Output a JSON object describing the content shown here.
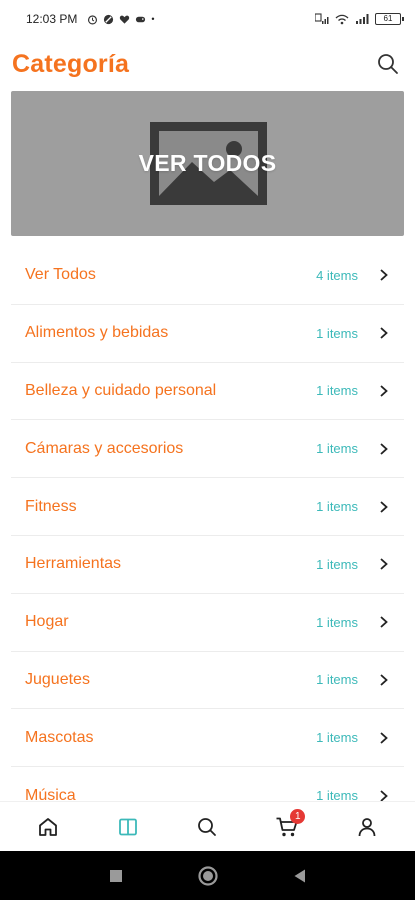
{
  "status_bar": {
    "time": "12:03 PM",
    "battery": "61"
  },
  "header": {
    "title": "Categoría"
  },
  "banner": {
    "label": "VER TODOS"
  },
  "categories": [
    {
      "name": "Ver Todos",
      "count": "4 items"
    },
    {
      "name": "Alimentos y bebidas",
      "count": "1 items"
    },
    {
      "name": "Belleza y cuidado personal",
      "count": "1 items"
    },
    {
      "name": "Cámaras y accesorios",
      "count": "1 items"
    },
    {
      "name": "Fitness",
      "count": "1 items"
    },
    {
      "name": "Herramientas",
      "count": "1 items"
    },
    {
      "name": "Hogar",
      "count": "1 items"
    },
    {
      "name": "Juguetes",
      "count": "1 items"
    },
    {
      "name": "Mascotas",
      "count": "1 items"
    },
    {
      "name": "Música",
      "count": "1 items"
    }
  ],
  "bottom_nav": {
    "cart_badge": "1",
    "active": "categories"
  },
  "colors": {
    "accent": "#f5731f",
    "count": "#3cb9b9",
    "active_tab": "#3cb9b9",
    "badge": "#e53935"
  }
}
